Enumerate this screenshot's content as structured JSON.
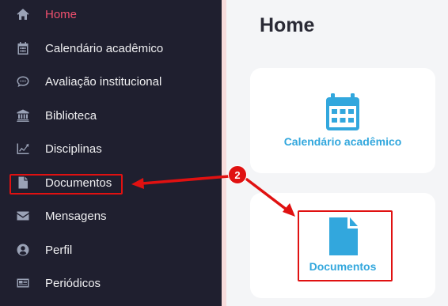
{
  "sidebar": {
    "items": [
      {
        "label": "Home",
        "icon": "home-icon",
        "active": true
      },
      {
        "label": "Calendário acadêmico",
        "icon": "calendar-icon"
      },
      {
        "label": "Avaliação institucional",
        "icon": "chat-bubble-icon"
      },
      {
        "label": "Biblioteca",
        "icon": "bank-icon"
      },
      {
        "label": "Disciplinas",
        "icon": "chart-line-icon"
      },
      {
        "label": "Documentos",
        "icon": "document-icon"
      },
      {
        "label": "Mensagens",
        "icon": "envelope-icon"
      },
      {
        "label": "Perfil",
        "icon": "user-circle-icon"
      },
      {
        "label": "Periódicos",
        "icon": "newspaper-icon"
      }
    ]
  },
  "main": {
    "title": "Home",
    "cards": [
      {
        "label": "Calendário acadêmico",
        "icon": "calendar-icon"
      },
      {
        "label": "Documentos",
        "icon": "document-icon"
      }
    ]
  },
  "annotation": {
    "step": "2",
    "color": "#e01111"
  },
  "colors": {
    "sidebar_bg": "#1f1f2f",
    "active": "#f0506e",
    "accent": "#32a7dd"
  }
}
